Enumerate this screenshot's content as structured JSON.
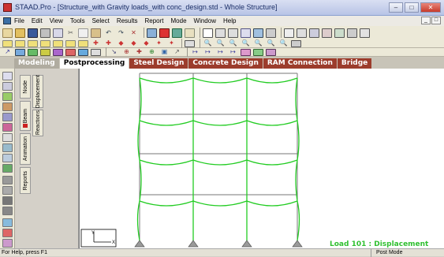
{
  "window": {
    "title": "STAAD.Pro - [Structure_with Gravity loads_with conc_design.std - Whole Structure]",
    "buttons": [
      "–",
      "□",
      "✕"
    ]
  },
  "menu": {
    "items": [
      "File",
      "Edit",
      "View",
      "Tools",
      "Select",
      "Results",
      "Report",
      "Mode",
      "Window",
      "Help"
    ],
    "mdi_buttons": [
      "_",
      "□"
    ]
  },
  "ribbon_tabs": {
    "model": "Modeling",
    "active": "Postprocessing",
    "others": [
      "Steel Design",
      "Concrete Design",
      "RAM Connection",
      "Bridge"
    ]
  },
  "side_tabs": {
    "left_column": [
      "Node",
      "Beam",
      "Animation",
      "Reports"
    ],
    "right_column": [
      "Displacement",
      "Reactions"
    ]
  },
  "viewport": {
    "load_caption": "Load 101 : Displacement",
    "axis_x": "X",
    "axis_y": "Y",
    "colors": {
      "frame": "#777777",
      "deflected": "#22cc22",
      "support": "#808080"
    }
  },
  "status": {
    "help": "For Help, press F1",
    "mode": "Post Mode"
  },
  "icons": {
    "toolbar1": [
      "new-icon",
      "open-icon",
      "save-icon",
      "print-icon",
      "preview-icon",
      "cut-icon",
      "copy-icon",
      "paste-icon",
      "undo-icon",
      "redo-icon",
      "delete-icon",
      "structure-icon",
      "stop-icon",
      "3d-icon",
      "rotate-icon",
      "zoom-window-icon",
      "select-icon"
    ],
    "colors": {
      "accent_tab": "#9c3c2c"
    }
  }
}
